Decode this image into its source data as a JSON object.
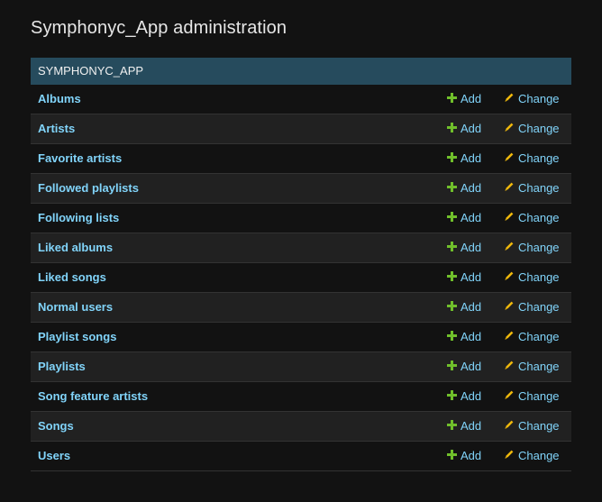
{
  "page": {
    "title": "Symphonyc_App administration"
  },
  "module": {
    "caption": "SYMPHONYC_APP",
    "add_label": "Add",
    "change_label": "Change",
    "models": [
      {
        "name": "Albums"
      },
      {
        "name": "Artists"
      },
      {
        "name": "Favorite artists"
      },
      {
        "name": "Followed playlists"
      },
      {
        "name": "Following lists"
      },
      {
        "name": "Liked albums"
      },
      {
        "name": "Liked songs"
      },
      {
        "name": "Normal users"
      },
      {
        "name": "Playlist songs"
      },
      {
        "name": "Playlists"
      },
      {
        "name": "Song feature artists"
      },
      {
        "name": "Songs"
      },
      {
        "name": "Users"
      }
    ]
  },
  "icons": {
    "add": "plus-icon",
    "change": "pencil-icon"
  },
  "colors": {
    "background": "#121212",
    "caption_bg": "#264b5d",
    "link": "#81d4fa",
    "add_icon": "#70bf2b",
    "change_icon": "#efb80b",
    "row_alt": "#212121"
  }
}
